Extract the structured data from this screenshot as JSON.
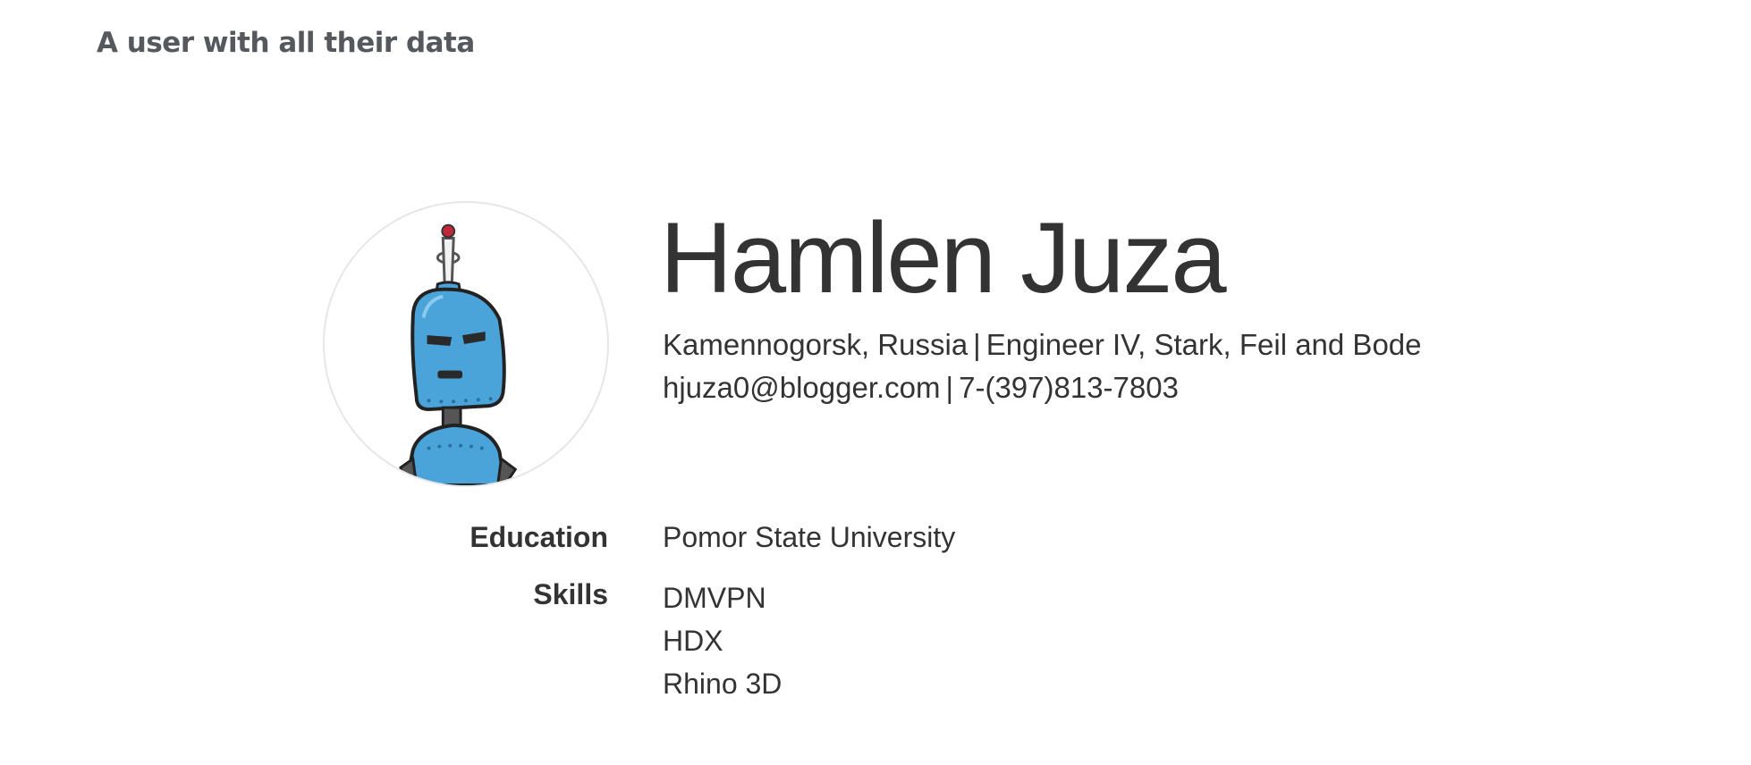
{
  "heading": "A user with all their data",
  "user": {
    "name": "Hamlen Juza",
    "location": "Kamennogorsk, Russia",
    "job": "Engineer IV, Stark, Feil and Bode",
    "email": "hjuza0@blogger.com",
    "phone": "7-(397)813-7803",
    "separator": "|",
    "avatar_icon": "robot-avatar-icon"
  },
  "details": {
    "education_label": "Education",
    "education_value": "Pomor State University",
    "skills_label": "Skills",
    "skills": [
      "DMVPN",
      "HDX",
      "Rhino 3D"
    ]
  },
  "colors": {
    "heading": "#55595d",
    "text": "#333333",
    "robot_blue": "#4aa3d9",
    "robot_dark": "#2a2a2a",
    "antenna_tip": "#c0283a"
  }
}
